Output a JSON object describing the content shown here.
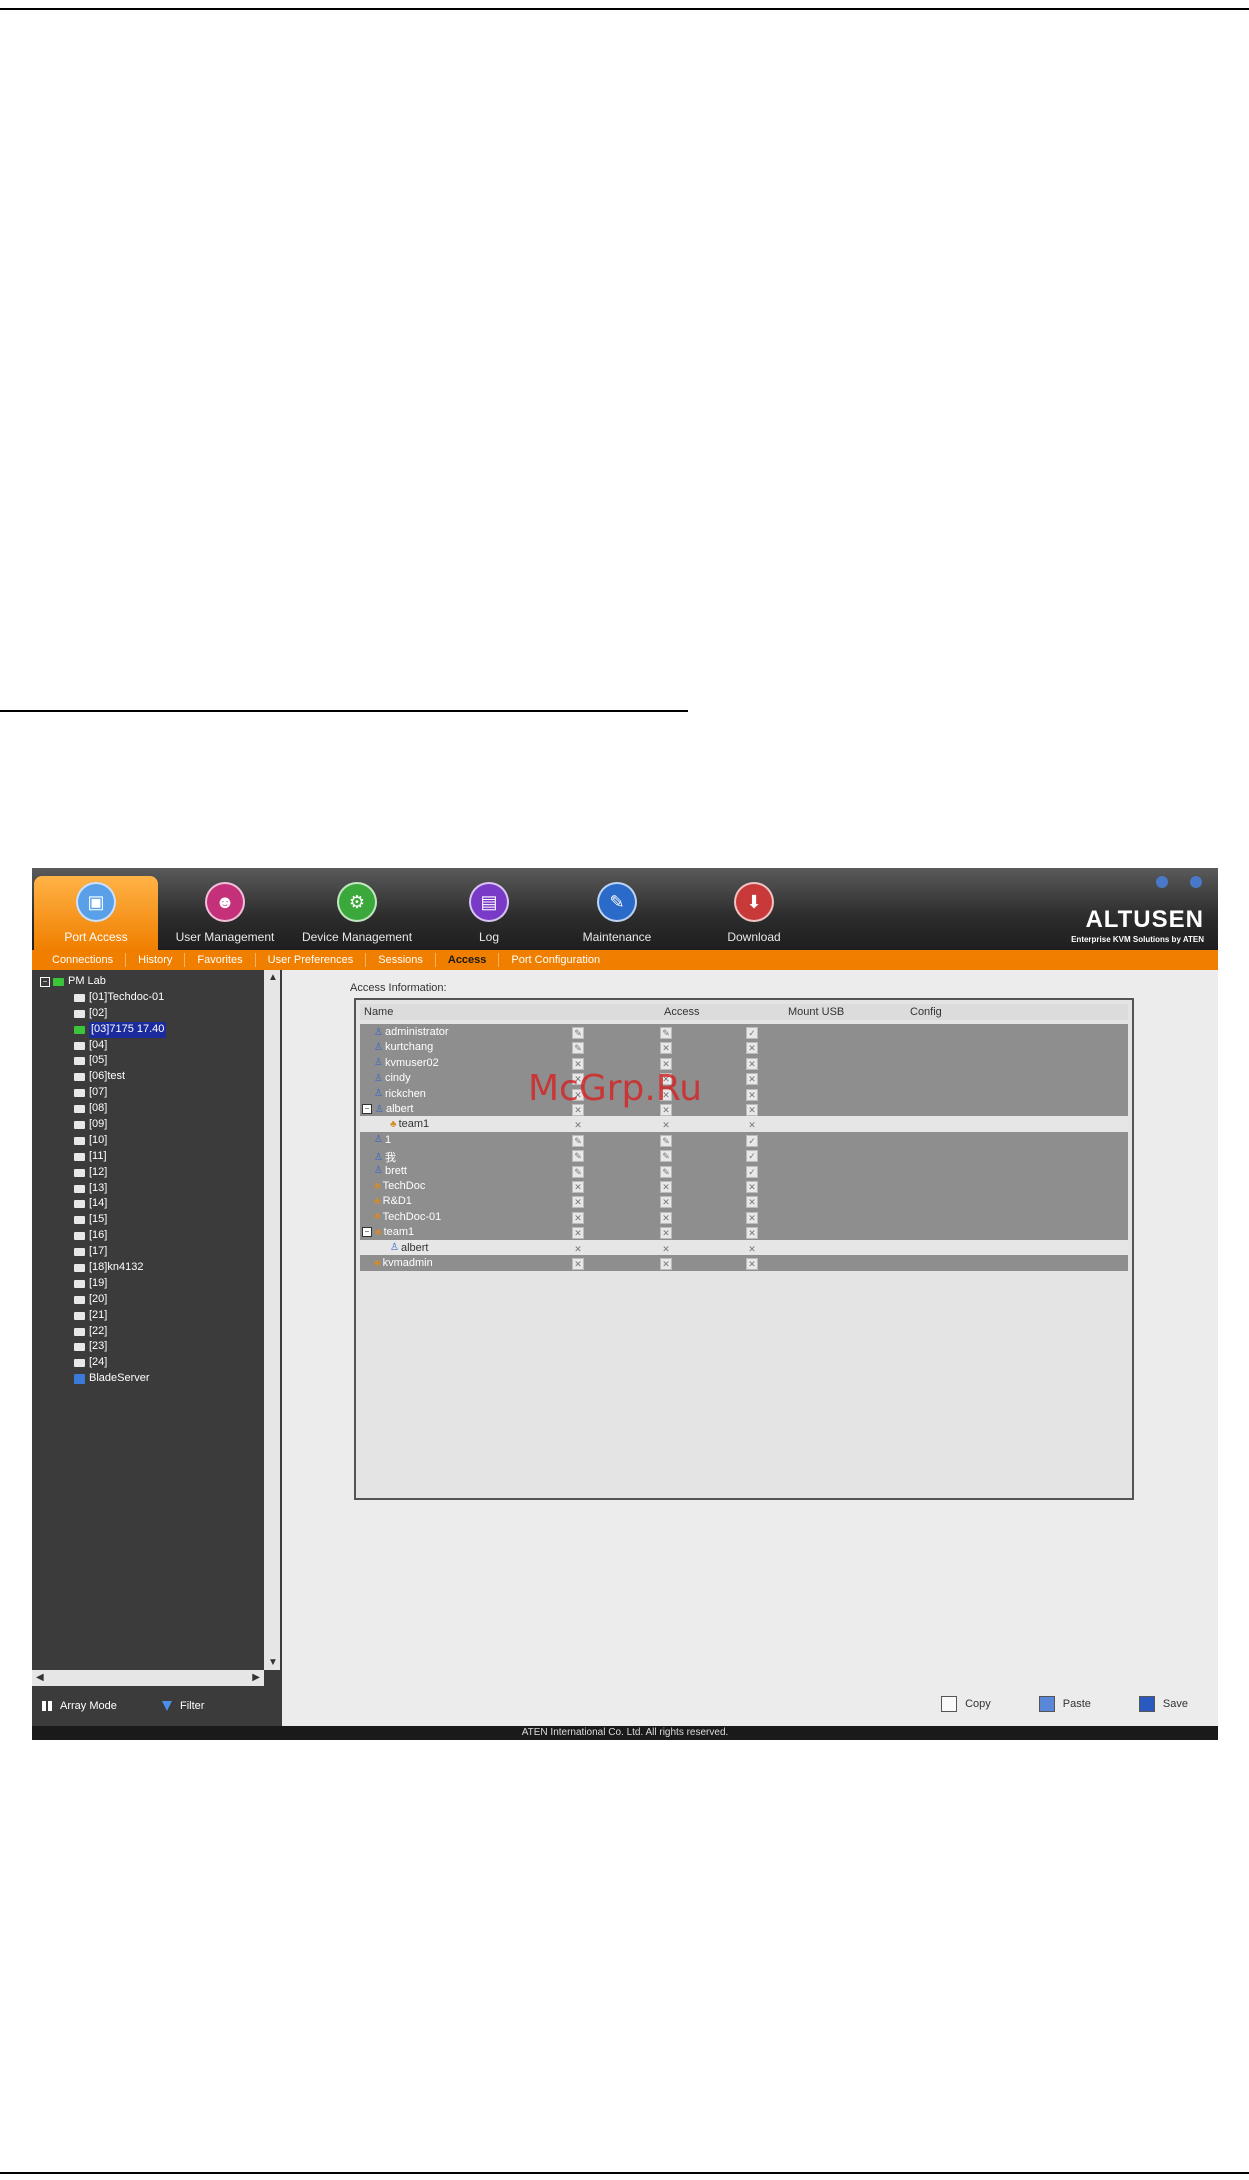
{
  "top_nav": [
    {
      "label": "Port Access",
      "icon": "port-access-icon",
      "active": true
    },
    {
      "label": "User Management",
      "icon": "user-management-icon",
      "active": false
    },
    {
      "label": "Device Management",
      "icon": "device-management-icon",
      "active": false
    },
    {
      "label": "Log",
      "icon": "log-icon",
      "active": false
    },
    {
      "label": "Maintenance",
      "icon": "maintenance-icon",
      "active": false
    },
    {
      "label": "Download",
      "icon": "download-icon",
      "active": false
    }
  ],
  "brand": {
    "logo": "ALTUSEN",
    "tagline": "Enterprise KVM Solutions by ATEN"
  },
  "sub_tabs": [
    {
      "label": "Connections",
      "active": false
    },
    {
      "label": "History",
      "active": false
    },
    {
      "label": "Favorites",
      "active": false
    },
    {
      "label": "User Preferences",
      "active": false
    },
    {
      "label": "Sessions",
      "active": false
    },
    {
      "label": "Access",
      "active": true
    },
    {
      "label": "Port Configuration",
      "active": false
    }
  ],
  "tree": {
    "root": "PM Lab",
    "ports": [
      "[01]Techdoc-01",
      "[02]",
      "[03]7175 17.40",
      "[04]",
      "[05]",
      "[06]test",
      "[07]",
      "[08]",
      "[09]",
      "[10]",
      "[11]",
      "[12]",
      "[13]",
      "[14]",
      "[15]",
      "[16]",
      "[17]",
      "[18]kn4132",
      "[19]",
      "[20]",
      "[21]",
      "[22]",
      "[23]",
      "[24]"
    ],
    "selected_index": 2,
    "extra": "BladeServer"
  },
  "left_bottom": {
    "array_mode": "Array Mode",
    "filter": "Filter"
  },
  "access": {
    "label": "Access Information:",
    "columns": [
      "Name",
      "Access",
      "Mount USB",
      "Config"
    ],
    "rows": [
      {
        "name": "administrator",
        "type": "user",
        "level": 0,
        "access": "edit",
        "usb": "edit",
        "config": "check"
      },
      {
        "name": "kurtchang",
        "type": "user",
        "level": 0,
        "access": "edit",
        "usb": "x",
        "config": "x"
      },
      {
        "name": "kvmuser02",
        "type": "user",
        "level": 0,
        "access": "x",
        "usb": "x",
        "config": "x"
      },
      {
        "name": "cindy",
        "type": "user",
        "level": 0,
        "access": "x",
        "usb": "x",
        "config": "x"
      },
      {
        "name": "rickchen",
        "type": "user",
        "level": 0,
        "access": "x",
        "usb": "x",
        "config": "x"
      },
      {
        "name": "albert",
        "type": "user",
        "level": 0,
        "expander": "−",
        "access": "x",
        "usb": "x",
        "config": "x"
      },
      {
        "name": "team1",
        "type": "group",
        "level": 1,
        "access": "x",
        "usb": "x",
        "config": "x"
      },
      {
        "name": "1",
        "type": "user",
        "level": 0,
        "access": "edit",
        "usb": "edit",
        "config": "check"
      },
      {
        "name": "我",
        "type": "user",
        "level": 0,
        "access": "edit",
        "usb": "edit",
        "config": "check"
      },
      {
        "name": "brett",
        "type": "user",
        "level": 0,
        "access": "edit",
        "usb": "edit",
        "config": "check"
      },
      {
        "name": "TechDoc",
        "type": "group",
        "level": 0,
        "access": "x",
        "usb": "x",
        "config": "x"
      },
      {
        "name": "R&D1",
        "type": "group",
        "level": 0,
        "access": "x",
        "usb": "x",
        "config": "x"
      },
      {
        "name": "TechDoc-01",
        "type": "group",
        "level": 0,
        "access": "x",
        "usb": "x",
        "config": "x"
      },
      {
        "name": "team1",
        "type": "group",
        "level": 0,
        "expander": "−",
        "access": "x",
        "usb": "x",
        "config": "x"
      },
      {
        "name": "albert",
        "type": "user",
        "level": 1,
        "access": "x",
        "usb": "x",
        "config": "x"
      },
      {
        "name": "kvmadmin",
        "type": "group",
        "level": 0,
        "access": "x",
        "usb": "x",
        "config": "x"
      }
    ]
  },
  "actions": [
    "Copy",
    "Paste",
    "Save"
  ],
  "footer": "ATEN International Co. Ltd. All rights reserved.",
  "watermark": "McGrp.Ru",
  "colors": {
    "accent": "#f07f00",
    "selected": "#1b2b9e"
  }
}
